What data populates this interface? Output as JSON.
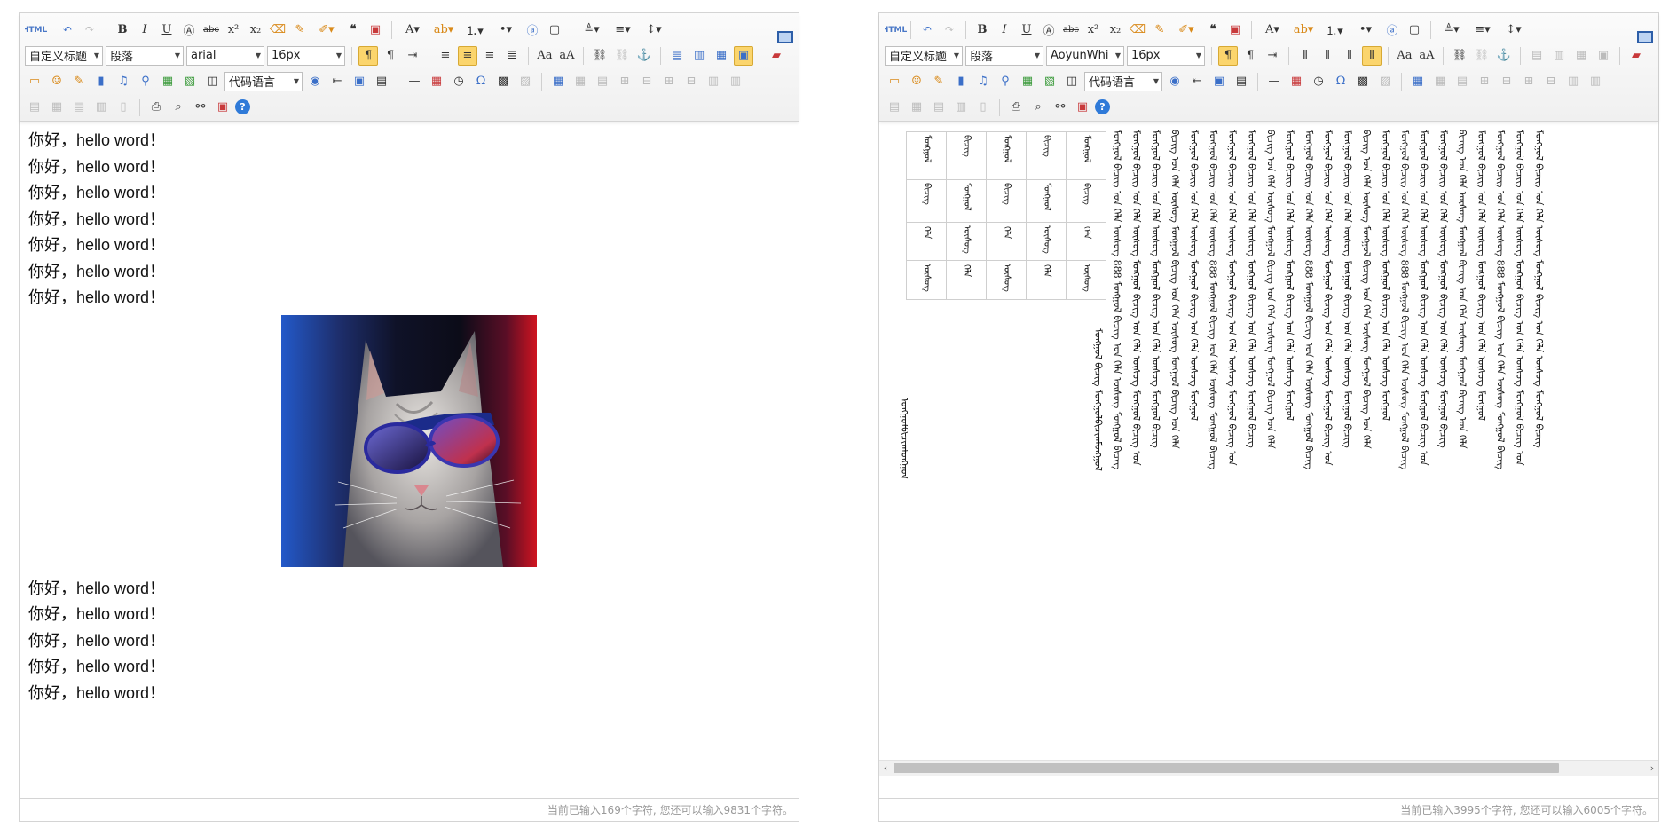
{
  "left_editor": {
    "toolbar": {
      "html_label": "HTML",
      "custom_heading": "自定义标题",
      "paragraph": "段落",
      "font_family": "arial",
      "font_size": "16px",
      "code_language": "代码语言"
    },
    "lines_top": [
      "你好，hello word！",
      "你好，hello word！",
      "你好，hello word！",
      "你好，hello word！",
      "你好，hello word！",
      "你好，hello word！",
      "你好，hello word！"
    ],
    "lines_bottom": [
      "你好，hello word！",
      "你好，hello word！",
      "你好，hello word！",
      "你好，hello word！",
      "你好，hello word！"
    ],
    "status": "当前已输入169个字符, 您还可以输入9831个字符。"
  },
  "right_editor": {
    "toolbar": {
      "html_label": "HTML",
      "custom_heading": "自定义标题",
      "paragraph": "段落",
      "font_family": "AoyunWhi",
      "font_size": "16px",
      "code_language": "代码语言"
    },
    "table_cells": [
      [
        "ᠮᠣᠩᠭᠣᠯ",
        "ᠪᠢᠴᠢᠭ",
        "ᠮᠣᠩᠭᠣᠯ",
        "ᠪᠢᠴᠢᠭ",
        "ᠮᠣᠩᠭᠣᠯ"
      ],
      [
        "ᠪᠢᠴᠢᠭ",
        "ᠮᠣᠩᠭᠣᠯ",
        "ᠪᠢᠴᠢᠭ",
        "ᠮᠣᠩᠭᠣᠯ",
        "ᠪᠢᠴᠢᠭ"
      ],
      [
        "ᠬᠡᠯᠡ",
        "ᠦᠰᠦᠭ",
        "ᠬᠡᠯᠡ",
        "ᠦᠰᠦᠭ",
        "ᠬᠡᠯᠡ"
      ],
      [
        "ᠦᠰᠦᠭ",
        "ᠬᠡᠯᠡ",
        "ᠦᠰᠦᠭ",
        "ᠬᠡᠯᠡ",
        "ᠦᠰᠦᠭ"
      ]
    ],
    "single_word": "ᠮᠣᠩᠭᠣᠯᠪᠢᠴᠢᠭᠮᠣᠩᠭᠣᠯ",
    "columns": [
      "ᠮᠣᠩᠭᠣᠯ ᠪᠢᠴᠢᠭ ᠮᠣᠩᠭᠣᠯᠪᠢᠴᠢᠭᠮᠣᠩᠭᠣᠯ",
      "ᠮᠣᠩᠭᠣᠯ ᠪᠢᠴᠢᠭ ᠤᠨ ᠬᠡᠯᠡ ᠦᠰᠦᠭ 888 ᠮᠣᠩᠭᠣᠯ ᠪᠢᠴᠢᠭ ᠤᠨ ᠬᠡᠯᠡ ᠦᠰᠦᠭ ᠮᠣᠩᠭᠣᠯ ᠪᠢᠴᠢᠭ",
      "ᠮᠣᠩᠭᠣᠯ ᠪᠢᠴᠢᠭ ᠤᠨ ᠬᠡᠯᠡ ᠦᠰᠦᠭ ᠮᠣᠩᠭᠣᠯ ᠪᠢᠴᠢᠭ ᠤᠨ ᠬᠡᠯᠡ ᠦᠰᠦᠭ ᠮᠣᠩᠭᠣᠯ ᠪᠢᠴᠢᠭ ᠤᠨ",
      "ᠮᠣᠩᠭᠣᠯ ᠪᠢᠴᠢᠭ ᠤᠨ ᠬᠡᠯᠡ ᠦᠰᠦᠭ ᠮᠣᠩᠭᠣᠯ ᠪᠢᠴᠢᠭ ᠤᠨ ᠬᠡᠯᠡ ᠦᠰᠦᠭ ᠮᠣᠩᠭᠣᠯ ᠪᠢᠴᠢᠭ",
      "ᠪᠢᠴᠢᠭ ᠤᠨ ᠬᠡᠯᠡ ᠦᠰᠦᠭ ᠮᠣᠩᠭᠣᠯ ᠪᠢᠴᠢᠭ ᠤᠨ ᠬᠡᠯᠡ ᠦᠰᠦᠭ ᠮᠣᠩᠭᠣᠯ ᠪᠢᠴᠢᠭ ᠤᠨ ᠬᠡᠯᠡ",
      "ᠮᠣᠩᠭᠣᠯ ᠪᠢᠴᠢᠭ ᠤᠨ ᠬᠡᠯᠡ ᠦᠰᠦᠭ ᠮᠣᠩᠭᠣᠯ ᠪᠢᠴᠢᠭ ᠤᠨ ᠬᠡᠯᠡ ᠦᠰᠦᠭ ᠮᠣᠩᠭᠣᠯ",
      "ᠮᠣᠩᠭᠣᠯ ᠪᠢᠴᠢᠭ ᠤᠨ ᠬᠡᠯᠡ ᠦᠰᠦᠭ 888 ᠮᠣᠩᠭᠣᠯ ᠪᠢᠴᠢᠭ ᠤᠨ ᠬᠡᠯᠡ ᠦᠰᠦᠭ ᠮᠣᠩᠭᠣᠯ ᠪᠢᠴᠢᠭ",
      "ᠮᠣᠩᠭᠣᠯ ᠪᠢᠴᠢᠭ ᠤᠨ ᠬᠡᠯᠡ ᠦᠰᠦᠭ ᠮᠣᠩᠭᠣᠯ ᠪᠢᠴᠢᠭ ᠤᠨ ᠬᠡᠯᠡ ᠦᠰᠦᠭ ᠮᠣᠩᠭᠣᠯ ᠪᠢᠴᠢᠭ ᠤᠨ",
      "ᠮᠣᠩᠭᠣᠯ ᠪᠢᠴᠢᠭ ᠤᠨ ᠬᠡᠯᠡ ᠦᠰᠦᠭ ᠮᠣᠩᠭᠣᠯ ᠪᠢᠴᠢᠭ ᠤᠨ ᠬᠡᠯᠡ ᠦᠰᠦᠭ ᠮᠣᠩᠭᠣᠯ ᠪᠢᠴᠢᠭ",
      "ᠪᠢᠴᠢᠭ ᠤᠨ ᠬᠡᠯᠡ ᠦᠰᠦᠭ ᠮᠣᠩᠭᠣᠯ ᠪᠢᠴᠢᠭ ᠤᠨ ᠬᠡᠯᠡ ᠦᠰᠦᠭ ᠮᠣᠩᠭᠣᠯ ᠪᠢᠴᠢᠭ ᠤᠨ ᠬᠡᠯᠡ",
      "ᠮᠣᠩᠭᠣᠯ ᠪᠢᠴᠢᠭ ᠤᠨ ᠬᠡᠯᠡ ᠦᠰᠦᠭ ᠮᠣᠩᠭᠣᠯ ᠪᠢᠴᠢᠭ ᠤᠨ ᠬᠡᠯᠡ ᠦᠰᠦᠭ ᠮᠣᠩᠭᠣᠯ",
      "ᠮᠣᠩᠭᠣᠯ ᠪᠢᠴᠢᠭ ᠤᠨ ᠬᠡᠯᠡ ᠦᠰᠦᠭ 888 ᠮᠣᠩᠭᠣᠯ ᠪᠢᠴᠢᠭ ᠤᠨ ᠬᠡᠯᠡ ᠦᠰᠦᠭ ᠮᠣᠩᠭᠣᠯ ᠪᠢᠴᠢᠭ",
      "ᠮᠣᠩᠭᠣᠯ ᠪᠢᠴᠢᠭ ᠤᠨ ᠬᠡᠯᠡ ᠦᠰᠦᠭ ᠮᠣᠩᠭᠣᠯ ᠪᠢᠴᠢᠭ ᠤᠨ ᠬᠡᠯᠡ ᠦᠰᠦᠭ ᠮᠣᠩᠭᠣᠯ ᠪᠢᠴᠢᠭ ᠤᠨ",
      "ᠮᠣᠩᠭᠣᠯ ᠪᠢᠴᠢᠭ ᠤᠨ ᠬᠡᠯᠡ ᠦᠰᠦᠭ ᠮᠣᠩᠭᠣᠯ ᠪᠢᠴᠢᠭ ᠤᠨ ᠬᠡᠯᠡ ᠦᠰᠦᠭ ᠮᠣᠩᠭᠣᠯ ᠪᠢᠴᠢᠭ",
      "ᠪᠢᠴᠢᠭ ᠤᠨ ᠬᠡᠯᠡ ᠦᠰᠦᠭ ᠮᠣᠩᠭᠣᠯ ᠪᠢᠴᠢᠭ ᠤᠨ ᠬᠡᠯᠡ ᠦᠰᠦᠭ ᠮᠣᠩᠭᠣᠯ ᠪᠢᠴᠢᠭ ᠤᠨ ᠬᠡᠯᠡ",
      "ᠮᠣᠩᠭᠣᠯ ᠪᠢᠴᠢᠭ ᠤᠨ ᠬᠡᠯᠡ ᠦᠰᠦᠭ ᠮᠣᠩᠭᠣᠯ ᠪᠢᠴᠢᠭ ᠤᠨ ᠬᠡᠯᠡ ᠦᠰᠦᠭ ᠮᠣᠩᠭᠣᠯ",
      "ᠮᠣᠩᠭᠣᠯ ᠪᠢᠴᠢᠭ ᠤᠨ ᠬᠡᠯᠡ ᠦᠰᠦᠭ 888 ᠮᠣᠩᠭᠣᠯ ᠪᠢᠴᠢᠭ ᠤᠨ ᠬᠡᠯᠡ ᠦᠰᠦᠭ ᠮᠣᠩᠭᠣᠯ ᠪᠢᠴᠢᠭ",
      "ᠮᠣᠩᠭᠣᠯ ᠪᠢᠴᠢᠭ ᠤᠨ ᠬᠡᠯᠡ ᠦᠰᠦᠭ ᠮᠣᠩᠭᠣᠯ ᠪᠢᠴᠢᠭ ᠤᠨ ᠬᠡᠯᠡ ᠦᠰᠦᠭ ᠮᠣᠩᠭᠣᠯ ᠪᠢᠴᠢᠭ ᠤᠨ",
      "ᠮᠣᠩᠭᠣᠯ ᠪᠢᠴᠢᠭ ᠤᠨ ᠬᠡᠯᠡ ᠦᠰᠦᠭ ᠮᠣᠩᠭᠣᠯ ᠪᠢᠴᠢᠭ ᠤᠨ ᠬᠡᠯᠡ ᠦᠰᠦᠭ ᠮᠣᠩᠭᠣᠯ ᠪᠢᠴᠢᠭ",
      "ᠪᠢᠴᠢᠭ ᠤᠨ ᠬᠡᠯᠡ ᠦᠰᠦᠭ ᠮᠣᠩᠭᠣᠯ ᠪᠢᠴᠢᠭ ᠤᠨ ᠬᠡᠯᠡ ᠦᠰᠦᠭ ᠮᠣᠩᠭᠣᠯ ᠪᠢᠴᠢᠭ ᠤᠨ ᠬᠡᠯᠡ",
      "ᠮᠣᠩᠭᠣᠯ ᠪᠢᠴᠢᠭ ᠤᠨ ᠬᠡᠯᠡ ᠦᠰᠦᠭ ᠮᠣᠩᠭᠣᠯ ᠪᠢᠴᠢᠭ ᠤᠨ ᠬᠡᠯᠡ ᠦᠰᠦᠭ ᠮᠣᠩᠭᠣᠯ",
      "ᠮᠣᠩᠭᠣᠯ ᠪᠢᠴᠢᠭ ᠤᠨ ᠬᠡᠯᠡ ᠦᠰᠦᠭ 888 ᠮᠣᠩᠭᠣᠯ ᠪᠢᠴᠢᠭ ᠤᠨ ᠬᠡᠯᠡ ᠦᠰᠦᠭ ᠮᠣᠩᠭᠣᠯ ᠪᠢᠴᠢᠭ",
      "ᠮᠣᠩᠭᠣᠯ ᠪᠢᠴᠢᠭ ᠤᠨ ᠬᠡᠯᠡ ᠦᠰᠦᠭ ᠮᠣᠩᠭᠣᠯ ᠪᠢᠴᠢᠭ ᠤᠨ ᠬᠡᠯᠡ ᠦᠰᠦᠭ ᠮᠣᠩᠭᠣᠯ ᠪᠢᠴᠢᠭ ᠤᠨ",
      "ᠮᠣᠩᠭᠣᠯ ᠪᠢᠴᠢᠭ ᠤᠨ ᠬᠡᠯᠡ ᠦᠰᠦᠭ ᠮᠣᠩᠭᠣᠯ ᠪᠢᠴᠢᠭ ᠤᠨ ᠬᠡᠯᠡ ᠦᠰᠦᠭ ᠮᠣᠩᠭᠣᠯ ᠪᠢᠴᠢᠭ"
    ],
    "status": "当前已输入3995个字符, 您还可以输入6005个字符。"
  }
}
